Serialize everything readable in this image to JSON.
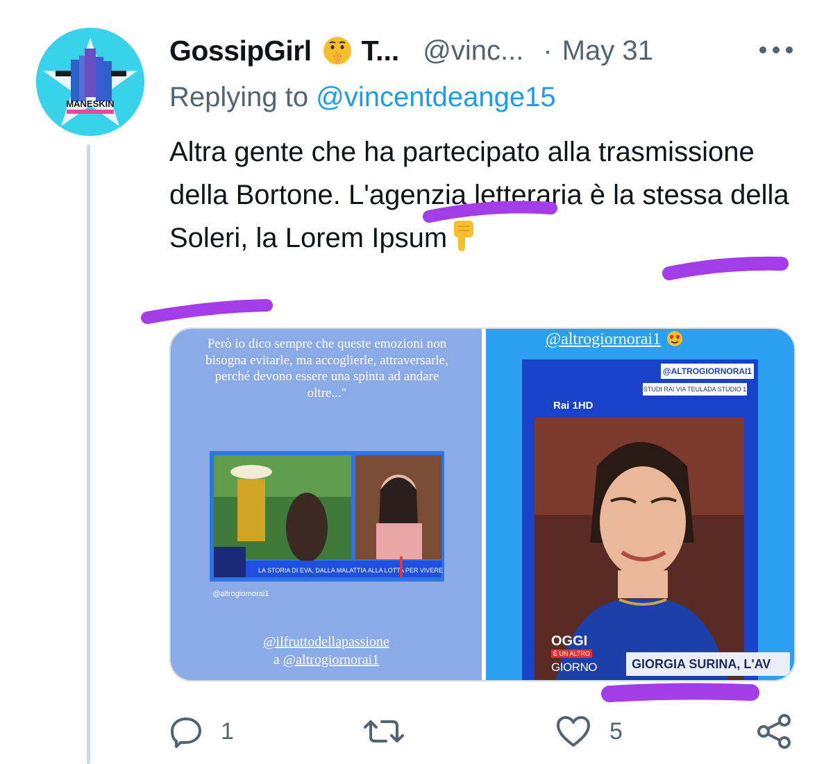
{
  "tweet": {
    "display_name": "GossipGirl",
    "display_name_truncated": "T...",
    "handle": "@vinc...",
    "separator": "·",
    "date": "May 31",
    "avatar_text": "MANESKIN",
    "reply_prefix": "Replying to",
    "reply_to": "@vincentdeange15",
    "text_part1": "Altra gente che ha partecipato alla trasmissione della Bortone. L'agenzia letteraria è la stessa della Soleri, la Lorem Ipsum",
    "emoji_after_name": "shushing-face-icon",
    "emoji_after_text": "point-down-icon"
  },
  "media": {
    "left": {
      "quote": "Però io dico sempre che queste emozioni non bisogna evitarle, ma accoglierle, attraversarle, perché devono essere una spinta ad andare oltre...\"",
      "video_caption": "LA STORIA DI EVA, DALLA MALATTIA ALLA LOTTA PER VIVERE",
      "credit": "@altrogiornorai1",
      "tag_line1": "@ilfruttodellapassione",
      "tag_line2_prefix": "a",
      "tag_line2_handle": "@altrogiornorai1"
    },
    "right": {
      "tag_top": "@altrogiornorai1",
      "badge": "@ALTROGIORNORAI1",
      "location": "STUDI RAI VIA TEULADA STUDIO 1",
      "channel": "Rai 1HD",
      "show_title": "OGGI",
      "show_sub": "È UN ALTRO",
      "show_giorno": "GIORNO",
      "lower_third": "GIORGIA SURINA, L'AV"
    }
  },
  "actions": {
    "reply_count": "1",
    "retweet_count": "",
    "like_count": "5",
    "share_count": ""
  },
  "colors": {
    "text": "#0f1419",
    "muted": "#536471",
    "link": "#1d9bf0",
    "highlight_scribble": "#a33de8",
    "avatar_bg": "#38d2ea"
  }
}
